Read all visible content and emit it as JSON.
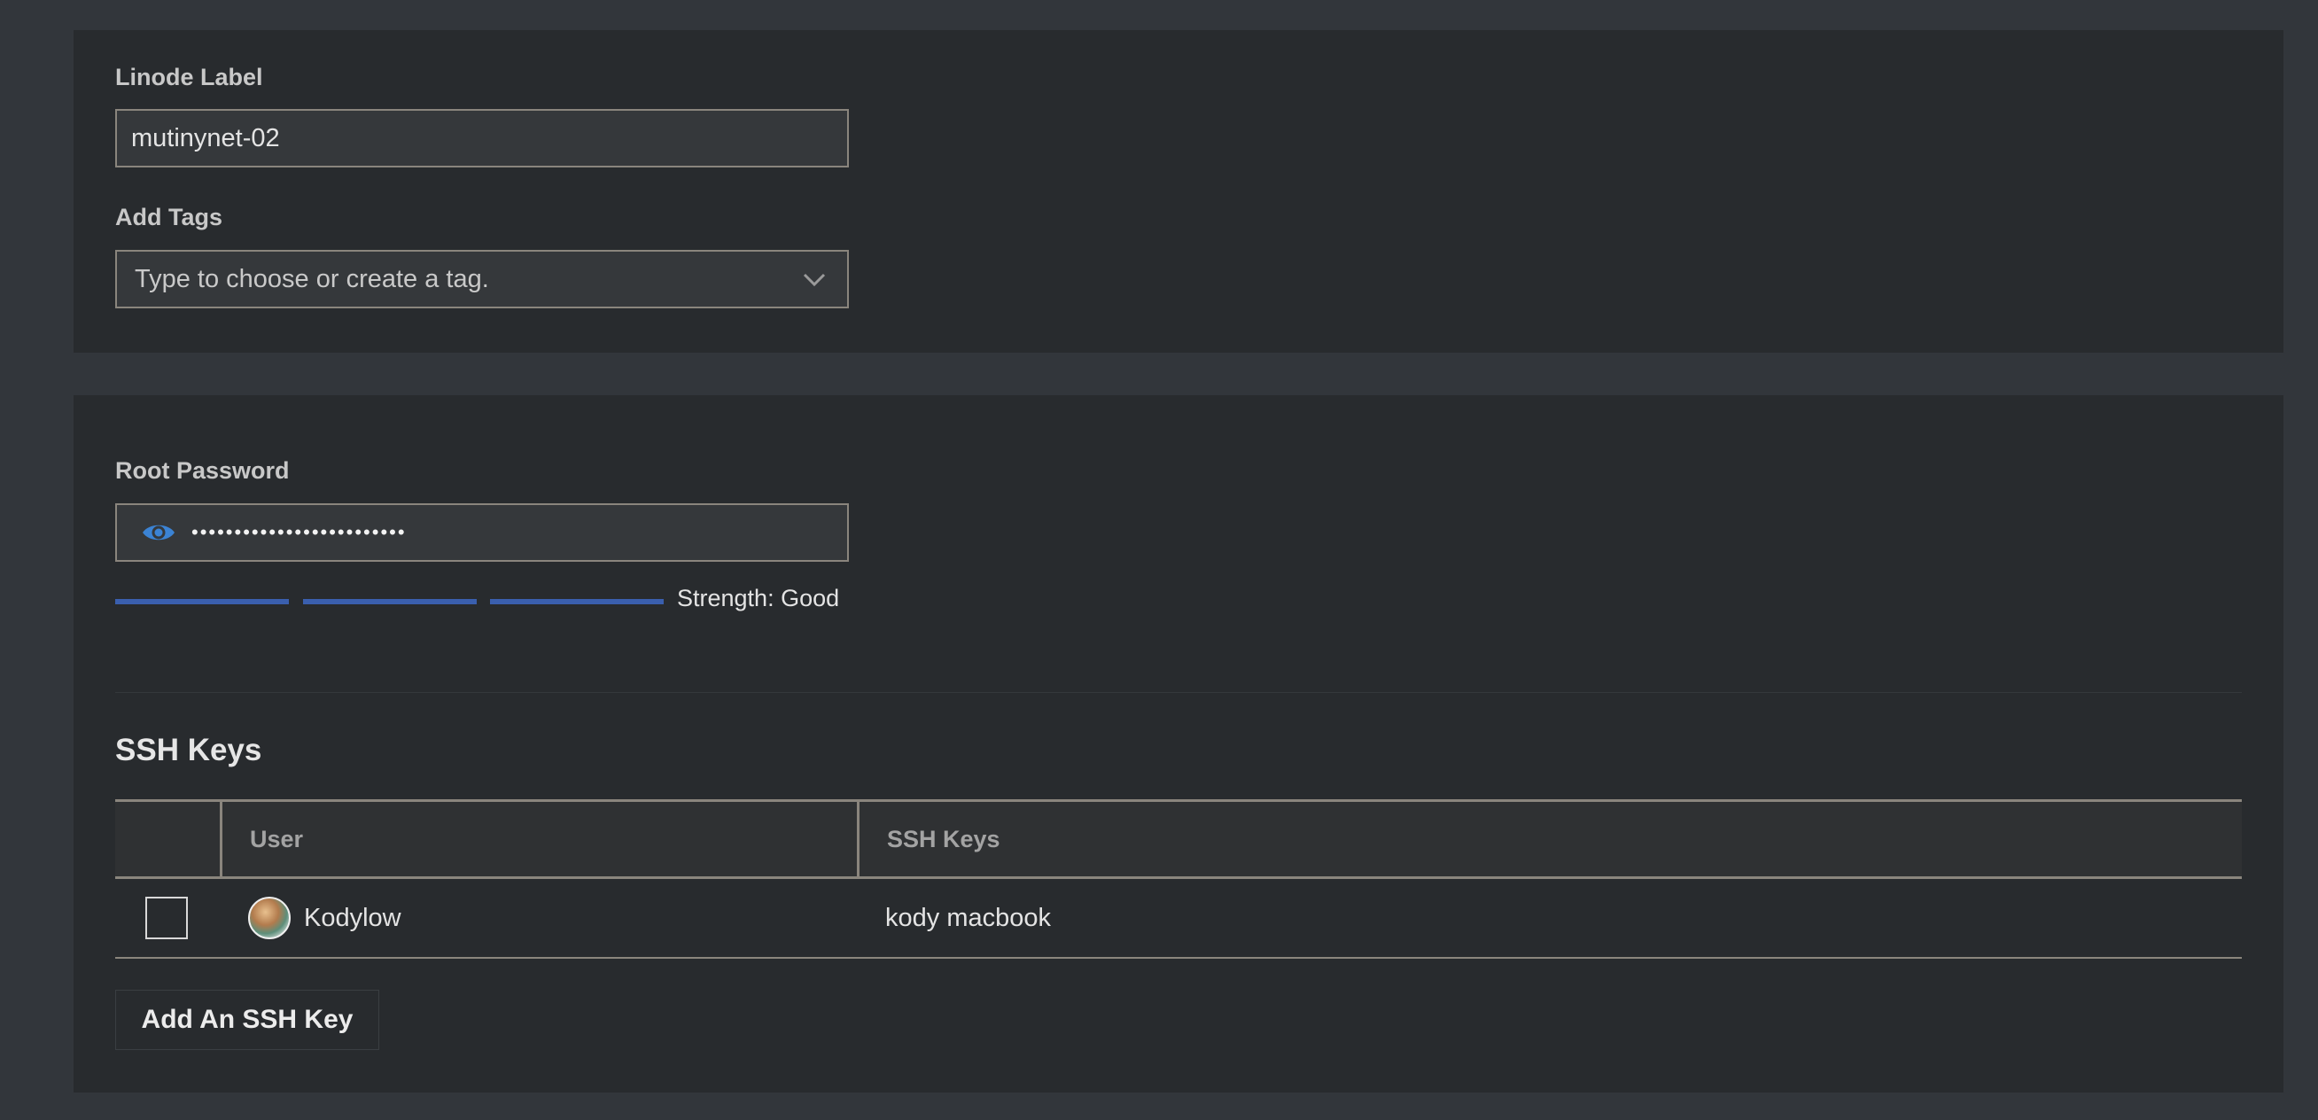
{
  "details": {
    "label_field": {
      "label": "Linode Label",
      "value": "mutinynet-02"
    },
    "tags_field": {
      "label": "Add Tags",
      "placeholder": "Type to choose or create a tag."
    }
  },
  "access": {
    "root_password": {
      "label": "Root Password",
      "masked_value": "•••••••••••••••••••••••••",
      "strength_segments_filled": 3,
      "strength_segments_total": 3,
      "strength_text": "Strength: Good"
    },
    "ssh_keys": {
      "title": "SSH Keys",
      "columns": [
        "User",
        "SSH Keys"
      ],
      "rows": [
        {
          "user": "Kodylow",
          "key": "kody macbook",
          "checked": false
        }
      ],
      "add_button_label": "Add An SSH Key"
    }
  },
  "colors": {
    "page_bg": "#32363b",
    "panel_bg": "#282b2e",
    "accent_blue": "#3a5fae",
    "eye_icon": "#3b83d4"
  }
}
